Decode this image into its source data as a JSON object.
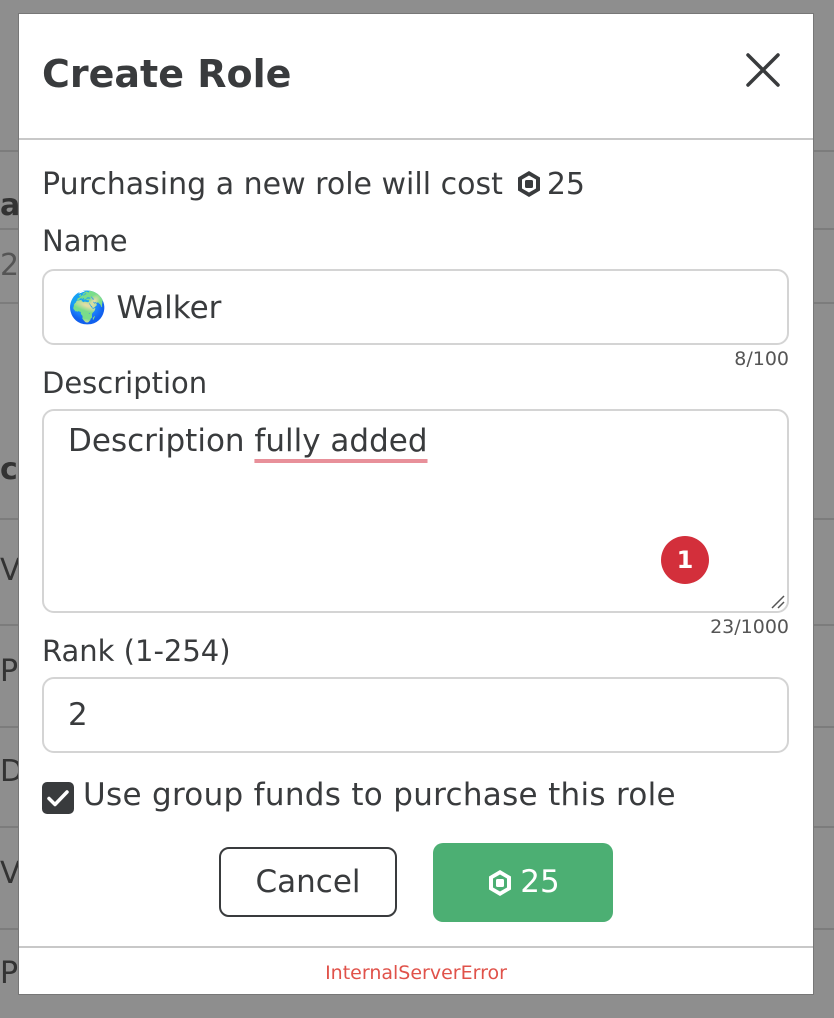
{
  "background_page": {
    "letters": [
      "a",
      "2",
      "c",
      "V",
      "P",
      "D",
      "V",
      "P"
    ]
  },
  "modal": {
    "title": "Create Role",
    "cost_text": "Purchasing a new role will cost",
    "cost_amount": "25",
    "name": {
      "label": "Name",
      "emoji": "🌍",
      "value": "Walker",
      "counter": "8/100"
    },
    "description": {
      "label": "Description",
      "value_plain": "Description ",
      "value_flagged": "fully added",
      "counter": "23/1000",
      "badge_count": "1"
    },
    "rank": {
      "label": "Rank (1-254)",
      "value": "2"
    },
    "use_group_funds": {
      "label": "Use group funds to purchase this role",
      "checked": true
    },
    "buttons": {
      "cancel": "Cancel",
      "purchase_amount": "25"
    },
    "error": "InternalServerError"
  },
  "colors": {
    "primary_text": "#393b3d",
    "purchase_button": "#4caf73",
    "badge": "#d32f3b",
    "error": "#e0524a"
  },
  "icons": [
    "close-icon",
    "robux-icon",
    "checkmark-icon",
    "resize-handle-icon",
    "globe-emoji"
  ]
}
